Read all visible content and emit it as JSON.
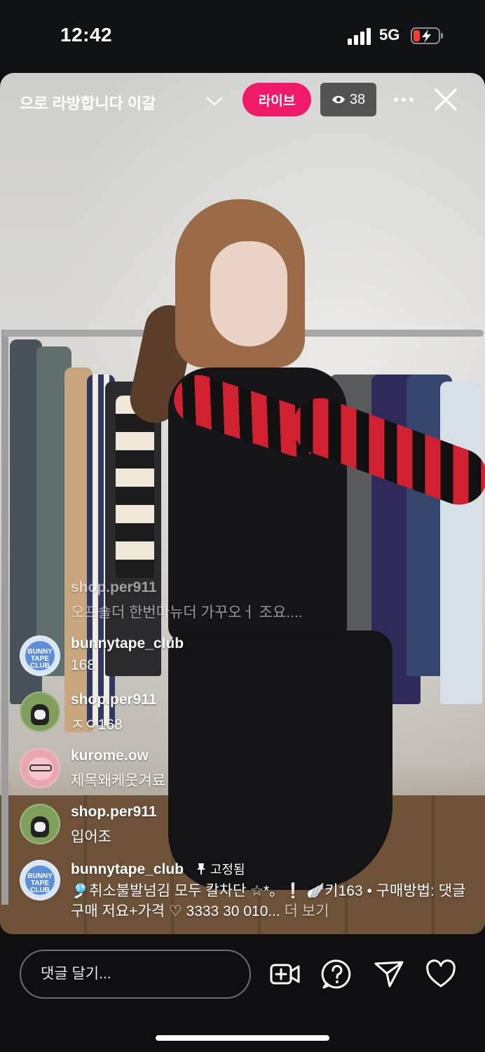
{
  "status_bar": {
    "time": "12:42",
    "network": "5G"
  },
  "header": {
    "broadcast_title": "으로 라방합니다  이갈",
    "live_label": "라이브",
    "viewer_count": "38"
  },
  "faded_comment": {
    "user": "shop.per911",
    "text": "오프숄더 한번마뉴더 가꾸오ㅓ 조요...."
  },
  "comments": [
    {
      "user": "bunnytape_club",
      "text": "168"
    },
    {
      "user": "shop.per911",
      "text": "ㅈㅇ168"
    },
    {
      "user": "kurome.ow",
      "text": "제목왜케웃겨료"
    },
    {
      "user": "shop.per911",
      "text": "입어조"
    }
  ],
  "pinned_comment": {
    "user": "bunnytape_club",
    "pinned_label": "고정됨",
    "text": "🎐취소불발넘김 모두 칼차단 ☆*。❕ 🪽키163 • 구매방법: 댓글구매 저요+가격 ♡ 3333 30 010...",
    "more_label": "더 보기"
  },
  "bottom_bar": {
    "comment_placeholder": "댓글 달기..."
  },
  "colors": {
    "live": "#f0196a",
    "background": "#0f0f12"
  }
}
